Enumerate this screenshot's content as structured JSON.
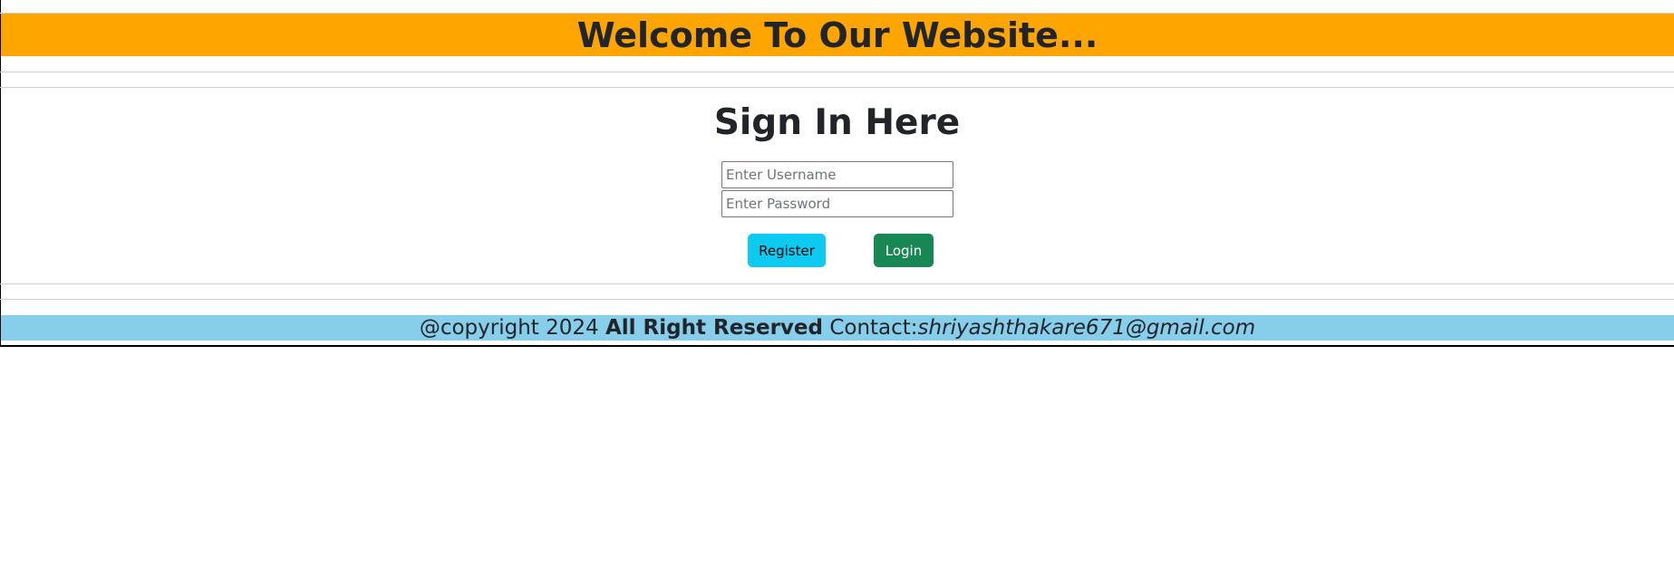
{
  "header": {
    "title": "Welcome To Our Website..."
  },
  "signin": {
    "title": "Sign In Here",
    "username_placeholder": "Enter Username",
    "password_placeholder": "Enter Password",
    "register_label": "Register",
    "login_label": "Login"
  },
  "footer": {
    "copyright": "@copyright 2024",
    "reserved": "All Right Reserved",
    "contact_label": "Contact:",
    "email": "shriyashthakare671@gmail.com"
  },
  "colors": {
    "header_bg": "#ffa500",
    "footer_bg": "#87ceeb",
    "register_bg": "#0dcaf0",
    "login_bg": "#198754"
  }
}
